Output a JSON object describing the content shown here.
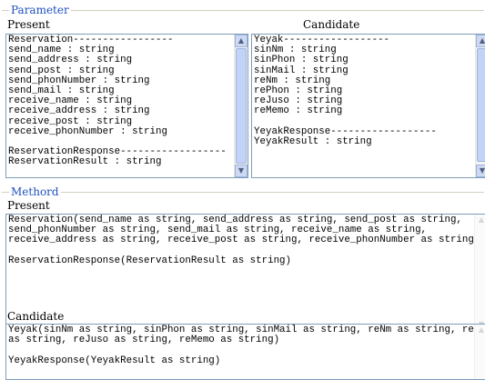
{
  "parameter": {
    "legend": "Parameter",
    "present_label": "Present",
    "candidate_label": "Candidate",
    "present_text": "Reservation-----------------\nsend_name : string\nsend_address : string\nsend_post : string\nsend_phonNumber : string\nsend_mail : string\nreceive_name : string\nreceive_address : string\nreceive_post : string\nreceive_phonNumber : string\n\nReservationResponse------------------\nReservationResult : string",
    "candidate_text": "Yeyak------------------\nsinNm : string\nsinPhon : string\nsinMail : string\nreNm : string\nrePhon : string\nreJuso : string\nreMemo : string\n\nYeyakResponse------------------\nYeyakResult : string"
  },
  "method": {
    "legend": "Methord",
    "present_label": "Present",
    "candidate_label": "Candidate",
    "present_text": "Reservation(send_name as string, send_address as string, send_post as string,\nsend_phonNumber as string, send_mail as string, receive_name as string,\nreceive_address as string, receive_post as string, receive_phonNumber as string)\n\nReservationResponse(ReservationResult as string)",
    "candidate_text": "Yeyak(sinNm as string, sinPhon as string, sinMail as string, reNm as string, rePhon\nas string, reJuso as string, reMemo as string)\n\nYeyakResponse(YeyakResult as string)"
  },
  "scrollbar": {
    "up_glyph": "▲",
    "down_glyph": "▼"
  }
}
